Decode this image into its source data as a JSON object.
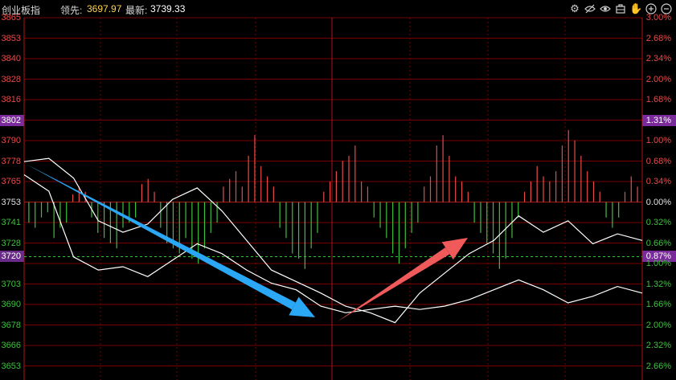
{
  "header": {
    "name": "创业板指",
    "lead_label": "领先:",
    "lead_value": "3697.97",
    "latest_label": "最新:",
    "latest_value": "3739.33"
  },
  "toolbar": {
    "icons": [
      "gear-icon",
      "eye-off-icon",
      "eye-icon",
      "toolbox-icon",
      "hand-icon",
      "zoom-in-icon",
      "zoom-out-icon"
    ]
  },
  "colors": {
    "background": "#000000",
    "grid": "#7a0000",
    "up": "#e84a4a",
    "down": "#3fbf3f",
    "neutral": "#e0e0e0",
    "highlight": "#7a2a9a",
    "index_line": "#ffffff",
    "blue_arrow": "#2aa7f5",
    "red_arrow": "#f05a5a"
  },
  "chart_data": {
    "type": "line",
    "left_axis": {
      "ticks": [
        "3865",
        "3853",
        "3840",
        "3828",
        "3816",
        "3802",
        "3790",
        "3778",
        "3765",
        "3753",
        "3741",
        "3728",
        "3720",
        "3703",
        "3690",
        "3678",
        "3666",
        "3653"
      ],
      "highlight": "3802",
      "current": "3720"
    },
    "right_axis": {
      "ticks": [
        "3.00%",
        "2.68%",
        "2.34%",
        "2.00%",
        "1.68%",
        "1.31%",
        "1.00%",
        "0.68%",
        "0.34%",
        "0.00%",
        "0.32%",
        "0.66%",
        "0.87%",
        "1.00%",
        "1.32%",
        "1.66%",
        "2.00%",
        "2.32%",
        "2.66%"
      ],
      "highlight": "1.31%",
      "current": "0.87%"
    },
    "series": [
      {
        "x": [
          0,
          4,
          8,
          12,
          16,
          20,
          24,
          28,
          32,
          36,
          40,
          44,
          48,
          52,
          56,
          60,
          64,
          68,
          72,
          76,
          80,
          84,
          88,
          92,
          96,
          100
        ],
        "y": [
          3778,
          3780,
          3768,
          3742,
          3735,
          3740,
          3755,
          3762,
          3748,
          3730,
          3712,
          3705,
          3698,
          3690,
          3686,
          3680,
          3698,
          3710,
          3722,
          3730,
          3745,
          3735,
          3742,
          3728,
          3734,
          3730
        ]
      },
      {
        "x": [
          0,
          4,
          8,
          12,
          16,
          20,
          24,
          28,
          32,
          36,
          40,
          44,
          48,
          52,
          56,
          60,
          64,
          68,
          72,
          76,
          80,
          84,
          88,
          92,
          96,
          100
        ],
        "y": [
          3770,
          3760,
          3720,
          3712,
          3714,
          3708,
          3718,
          3728,
          3722,
          3712,
          3704,
          3700,
          3690,
          3686,
          3688,
          3690,
          3688,
          3690,
          3694,
          3700,
          3706,
          3700,
          3692,
          3696,
          3702,
          3698
        ]
      }
    ],
    "divergence_bars": [
      -8,
      -10,
      -6,
      -4,
      -14,
      -10,
      -8,
      3,
      6,
      4,
      -6,
      -12,
      -14,
      -16,
      -18,
      -10,
      -8,
      -6,
      7,
      9,
      4,
      -10,
      -16,
      -18,
      -20,
      -14,
      -22,
      -24,
      -18,
      -12,
      -8,
      6,
      9,
      12,
      6,
      18,
      26,
      14,
      10,
      6,
      -10,
      -14,
      -20,
      -22,
      -26,
      -18,
      -12,
      4,
      8,
      12,
      16,
      18,
      22,
      8,
      6,
      -6,
      -10,
      -14,
      -20,
      -24,
      -18,
      -12,
      -8,
      6,
      10,
      22,
      26,
      18,
      10,
      8,
      4,
      -8,
      -12,
      -16,
      -20,
      -26,
      -22,
      -14,
      -6,
      4,
      8,
      14,
      10,
      8,
      12,
      22,
      28,
      24,
      18,
      12,
      8,
      4,
      -6,
      -10,
      -6,
      4,
      10,
      6
    ]
  }
}
